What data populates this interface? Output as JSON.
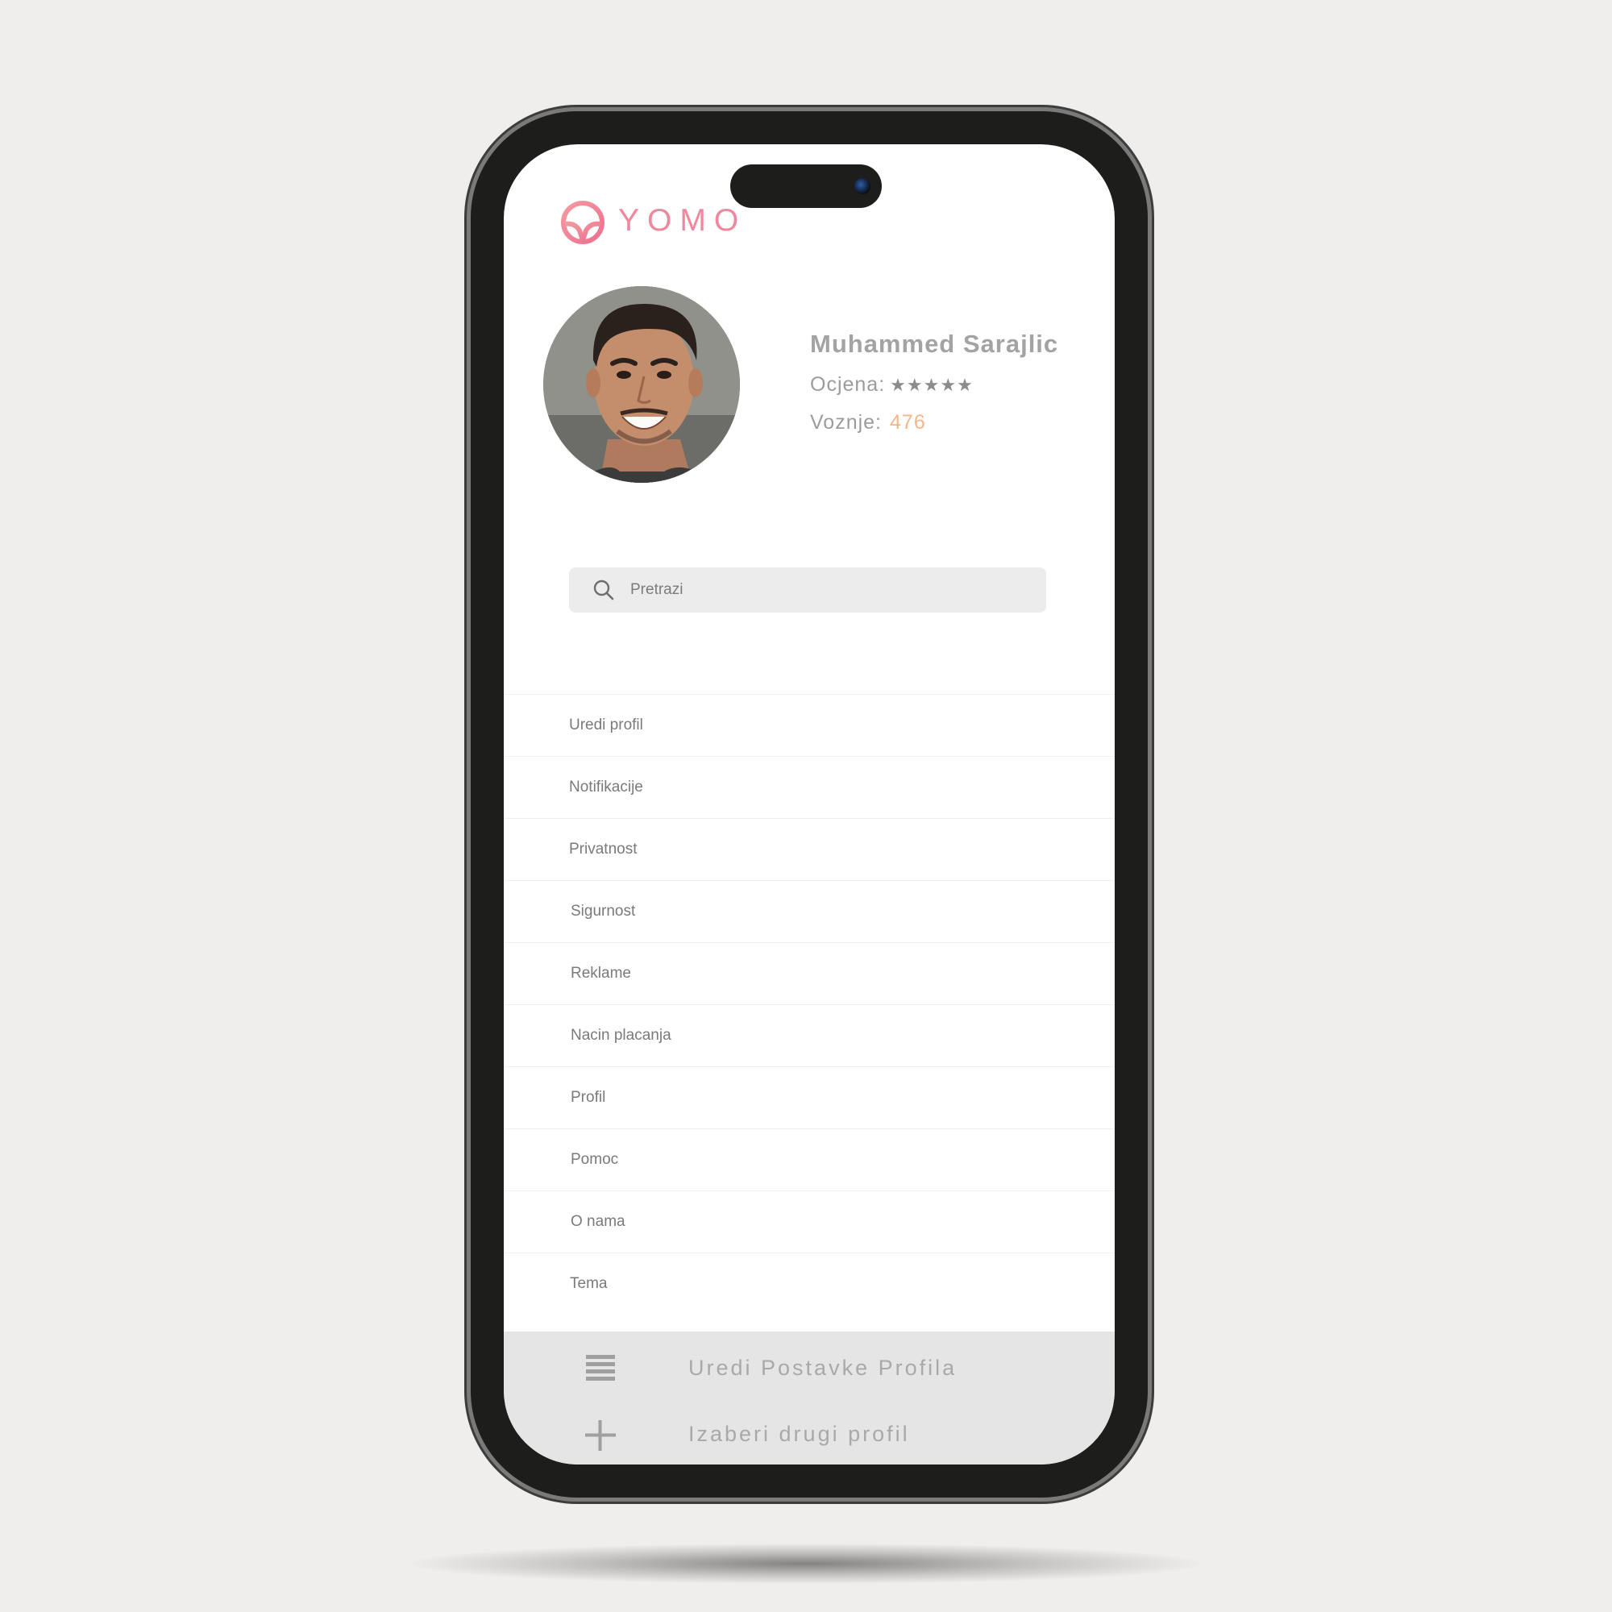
{
  "app": {
    "brand_name": "YOMO",
    "brand_color": "#f0889d",
    "icons": {
      "logo": "steering-wheel-power-icon",
      "search": "search-icon",
      "edit_settings": "hamburger-menu-icon",
      "add_profile": "plus-icon"
    }
  },
  "profile": {
    "name": "Muhammed Sarajlic",
    "rating_label": "Ocjena:",
    "rating_stars": "★★★★★",
    "rating_value": 5,
    "rides_label": "Voznje:",
    "rides_count": "476",
    "rides_color": "#f5b58a"
  },
  "search": {
    "placeholder": "Pretrazi"
  },
  "menu": {
    "items": [
      {
        "label": "Uredi profil"
      },
      {
        "label": "Notifikacije"
      },
      {
        "label": "Privatnost"
      },
      {
        "label": "Sigurnost"
      },
      {
        "label": "Reklame"
      },
      {
        "label": "Nacin placanja"
      },
      {
        "label": "Profil"
      },
      {
        "label": "Pomoc"
      },
      {
        "label": "O nama"
      },
      {
        "label": "Tema"
      }
    ]
  },
  "bottom": {
    "edit_settings_label": "Uredi Postavke Profila",
    "switch_profile_label": "Izaberi drugi profil"
  }
}
